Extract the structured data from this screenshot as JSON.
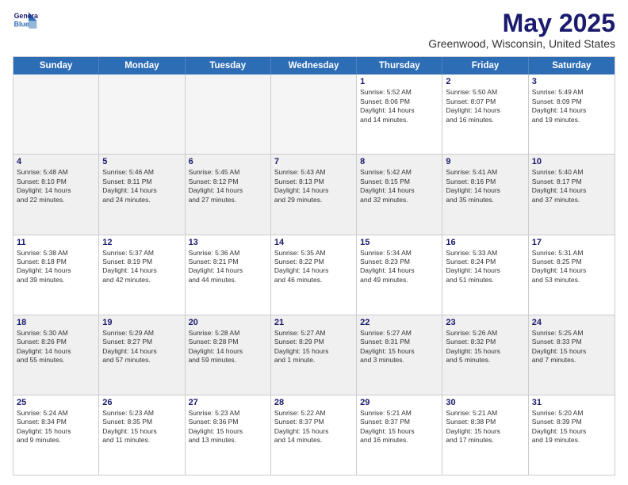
{
  "header": {
    "logo_line1": "General",
    "logo_line2": "Blue",
    "month": "May 2025",
    "location": "Greenwood, Wisconsin, United States"
  },
  "weekdays": [
    "Sunday",
    "Monday",
    "Tuesday",
    "Wednesday",
    "Thursday",
    "Friday",
    "Saturday"
  ],
  "rows": [
    [
      {
        "day": "",
        "empty": true
      },
      {
        "day": "",
        "empty": true
      },
      {
        "day": "",
        "empty": true
      },
      {
        "day": "",
        "empty": true
      },
      {
        "day": "1",
        "lines": [
          "Sunrise: 5:52 AM",
          "Sunset: 8:06 PM",
          "Daylight: 14 hours",
          "and 14 minutes."
        ]
      },
      {
        "day": "2",
        "lines": [
          "Sunrise: 5:50 AM",
          "Sunset: 8:07 PM",
          "Daylight: 14 hours",
          "and 16 minutes."
        ]
      },
      {
        "day": "3",
        "lines": [
          "Sunrise: 5:49 AM",
          "Sunset: 8:09 PM",
          "Daylight: 14 hours",
          "and 19 minutes."
        ]
      }
    ],
    [
      {
        "day": "4",
        "lines": [
          "Sunrise: 5:48 AM",
          "Sunset: 8:10 PM",
          "Daylight: 14 hours",
          "and 22 minutes."
        ]
      },
      {
        "day": "5",
        "lines": [
          "Sunrise: 5:46 AM",
          "Sunset: 8:11 PM",
          "Daylight: 14 hours",
          "and 24 minutes."
        ]
      },
      {
        "day": "6",
        "lines": [
          "Sunrise: 5:45 AM",
          "Sunset: 8:12 PM",
          "Daylight: 14 hours",
          "and 27 minutes."
        ]
      },
      {
        "day": "7",
        "lines": [
          "Sunrise: 5:43 AM",
          "Sunset: 8:13 PM",
          "Daylight: 14 hours",
          "and 29 minutes."
        ]
      },
      {
        "day": "8",
        "lines": [
          "Sunrise: 5:42 AM",
          "Sunset: 8:15 PM",
          "Daylight: 14 hours",
          "and 32 minutes."
        ]
      },
      {
        "day": "9",
        "lines": [
          "Sunrise: 5:41 AM",
          "Sunset: 8:16 PM",
          "Daylight: 14 hours",
          "and 35 minutes."
        ]
      },
      {
        "day": "10",
        "lines": [
          "Sunrise: 5:40 AM",
          "Sunset: 8:17 PM",
          "Daylight: 14 hours",
          "and 37 minutes."
        ]
      }
    ],
    [
      {
        "day": "11",
        "lines": [
          "Sunrise: 5:38 AM",
          "Sunset: 8:18 PM",
          "Daylight: 14 hours",
          "and 39 minutes."
        ]
      },
      {
        "day": "12",
        "lines": [
          "Sunrise: 5:37 AM",
          "Sunset: 8:19 PM",
          "Daylight: 14 hours",
          "and 42 minutes."
        ]
      },
      {
        "day": "13",
        "lines": [
          "Sunrise: 5:36 AM",
          "Sunset: 8:21 PM",
          "Daylight: 14 hours",
          "and 44 minutes."
        ]
      },
      {
        "day": "14",
        "lines": [
          "Sunrise: 5:35 AM",
          "Sunset: 8:22 PM",
          "Daylight: 14 hours",
          "and 46 minutes."
        ]
      },
      {
        "day": "15",
        "lines": [
          "Sunrise: 5:34 AM",
          "Sunset: 8:23 PM",
          "Daylight: 14 hours",
          "and 49 minutes."
        ]
      },
      {
        "day": "16",
        "lines": [
          "Sunrise: 5:33 AM",
          "Sunset: 8:24 PM",
          "Daylight: 14 hours",
          "and 51 minutes."
        ]
      },
      {
        "day": "17",
        "lines": [
          "Sunrise: 5:31 AM",
          "Sunset: 8:25 PM",
          "Daylight: 14 hours",
          "and 53 minutes."
        ]
      }
    ],
    [
      {
        "day": "18",
        "lines": [
          "Sunrise: 5:30 AM",
          "Sunset: 8:26 PM",
          "Daylight: 14 hours",
          "and 55 minutes."
        ]
      },
      {
        "day": "19",
        "lines": [
          "Sunrise: 5:29 AM",
          "Sunset: 8:27 PM",
          "Daylight: 14 hours",
          "and 57 minutes."
        ]
      },
      {
        "day": "20",
        "lines": [
          "Sunrise: 5:28 AM",
          "Sunset: 8:28 PM",
          "Daylight: 14 hours",
          "and 59 minutes."
        ]
      },
      {
        "day": "21",
        "lines": [
          "Sunrise: 5:27 AM",
          "Sunset: 8:29 PM",
          "Daylight: 15 hours",
          "and 1 minute."
        ]
      },
      {
        "day": "22",
        "lines": [
          "Sunrise: 5:27 AM",
          "Sunset: 8:31 PM",
          "Daylight: 15 hours",
          "and 3 minutes."
        ]
      },
      {
        "day": "23",
        "lines": [
          "Sunrise: 5:26 AM",
          "Sunset: 8:32 PM",
          "Daylight: 15 hours",
          "and 5 minutes."
        ]
      },
      {
        "day": "24",
        "lines": [
          "Sunrise: 5:25 AM",
          "Sunset: 8:33 PM",
          "Daylight: 15 hours",
          "and 7 minutes."
        ]
      }
    ],
    [
      {
        "day": "25",
        "lines": [
          "Sunrise: 5:24 AM",
          "Sunset: 8:34 PM",
          "Daylight: 15 hours",
          "and 9 minutes."
        ]
      },
      {
        "day": "26",
        "lines": [
          "Sunrise: 5:23 AM",
          "Sunset: 8:35 PM",
          "Daylight: 15 hours",
          "and 11 minutes."
        ]
      },
      {
        "day": "27",
        "lines": [
          "Sunrise: 5:23 AM",
          "Sunset: 8:36 PM",
          "Daylight: 15 hours",
          "and 13 minutes."
        ]
      },
      {
        "day": "28",
        "lines": [
          "Sunrise: 5:22 AM",
          "Sunset: 8:37 PM",
          "Daylight: 15 hours",
          "and 14 minutes."
        ]
      },
      {
        "day": "29",
        "lines": [
          "Sunrise: 5:21 AM",
          "Sunset: 8:37 PM",
          "Daylight: 15 hours",
          "and 16 minutes."
        ]
      },
      {
        "day": "30",
        "lines": [
          "Sunrise: 5:21 AM",
          "Sunset: 8:38 PM",
          "Daylight: 15 hours",
          "and 17 minutes."
        ]
      },
      {
        "day": "31",
        "lines": [
          "Sunrise: 5:20 AM",
          "Sunset: 8:39 PM",
          "Daylight: 15 hours",
          "and 19 minutes."
        ]
      }
    ]
  ]
}
